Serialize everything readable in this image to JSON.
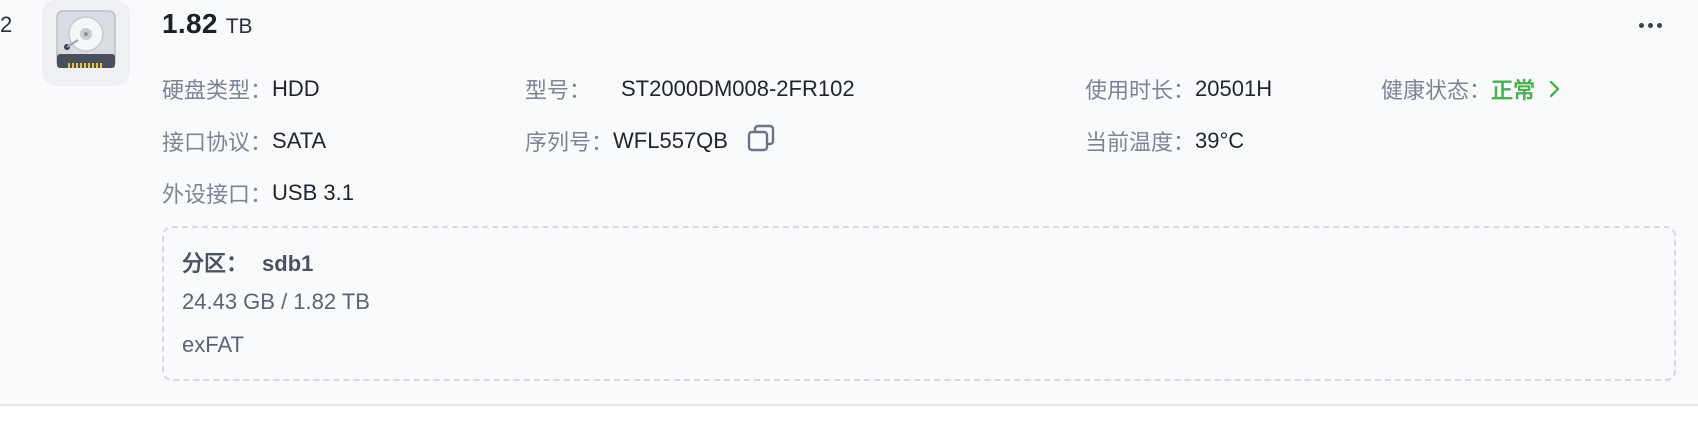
{
  "disk": {
    "index": "2",
    "capacity_value": "1.82",
    "capacity_unit": "TB",
    "icon": "hard-disk-icon"
  },
  "details": {
    "disk_type": {
      "label": "硬盘类型：",
      "value": "HDD"
    },
    "model": {
      "label": "型号：",
      "value": "ST2000DM008-2FR102"
    },
    "usage_time": {
      "label": "使用时长：",
      "value": "20501H"
    },
    "health": {
      "label": "健康状态：",
      "value": "正常",
      "color": "#4caf50"
    },
    "interface": {
      "label": "接口协议：",
      "value": "SATA"
    },
    "serial": {
      "label": "序列号：",
      "value": "WFL557QB",
      "copy_icon": "copy-icon"
    },
    "temperature": {
      "label": "当前温度：",
      "value": "39°C"
    },
    "external_port": {
      "label": "外设接口：",
      "value": "USB 3.1"
    }
  },
  "partition": {
    "label": "分区：",
    "name": "sdb1",
    "usage": "24.43 GB / 1.82 TB",
    "filesystem": "exFAT"
  },
  "actions": {
    "more_icon": "more-horizontal-icon"
  }
}
